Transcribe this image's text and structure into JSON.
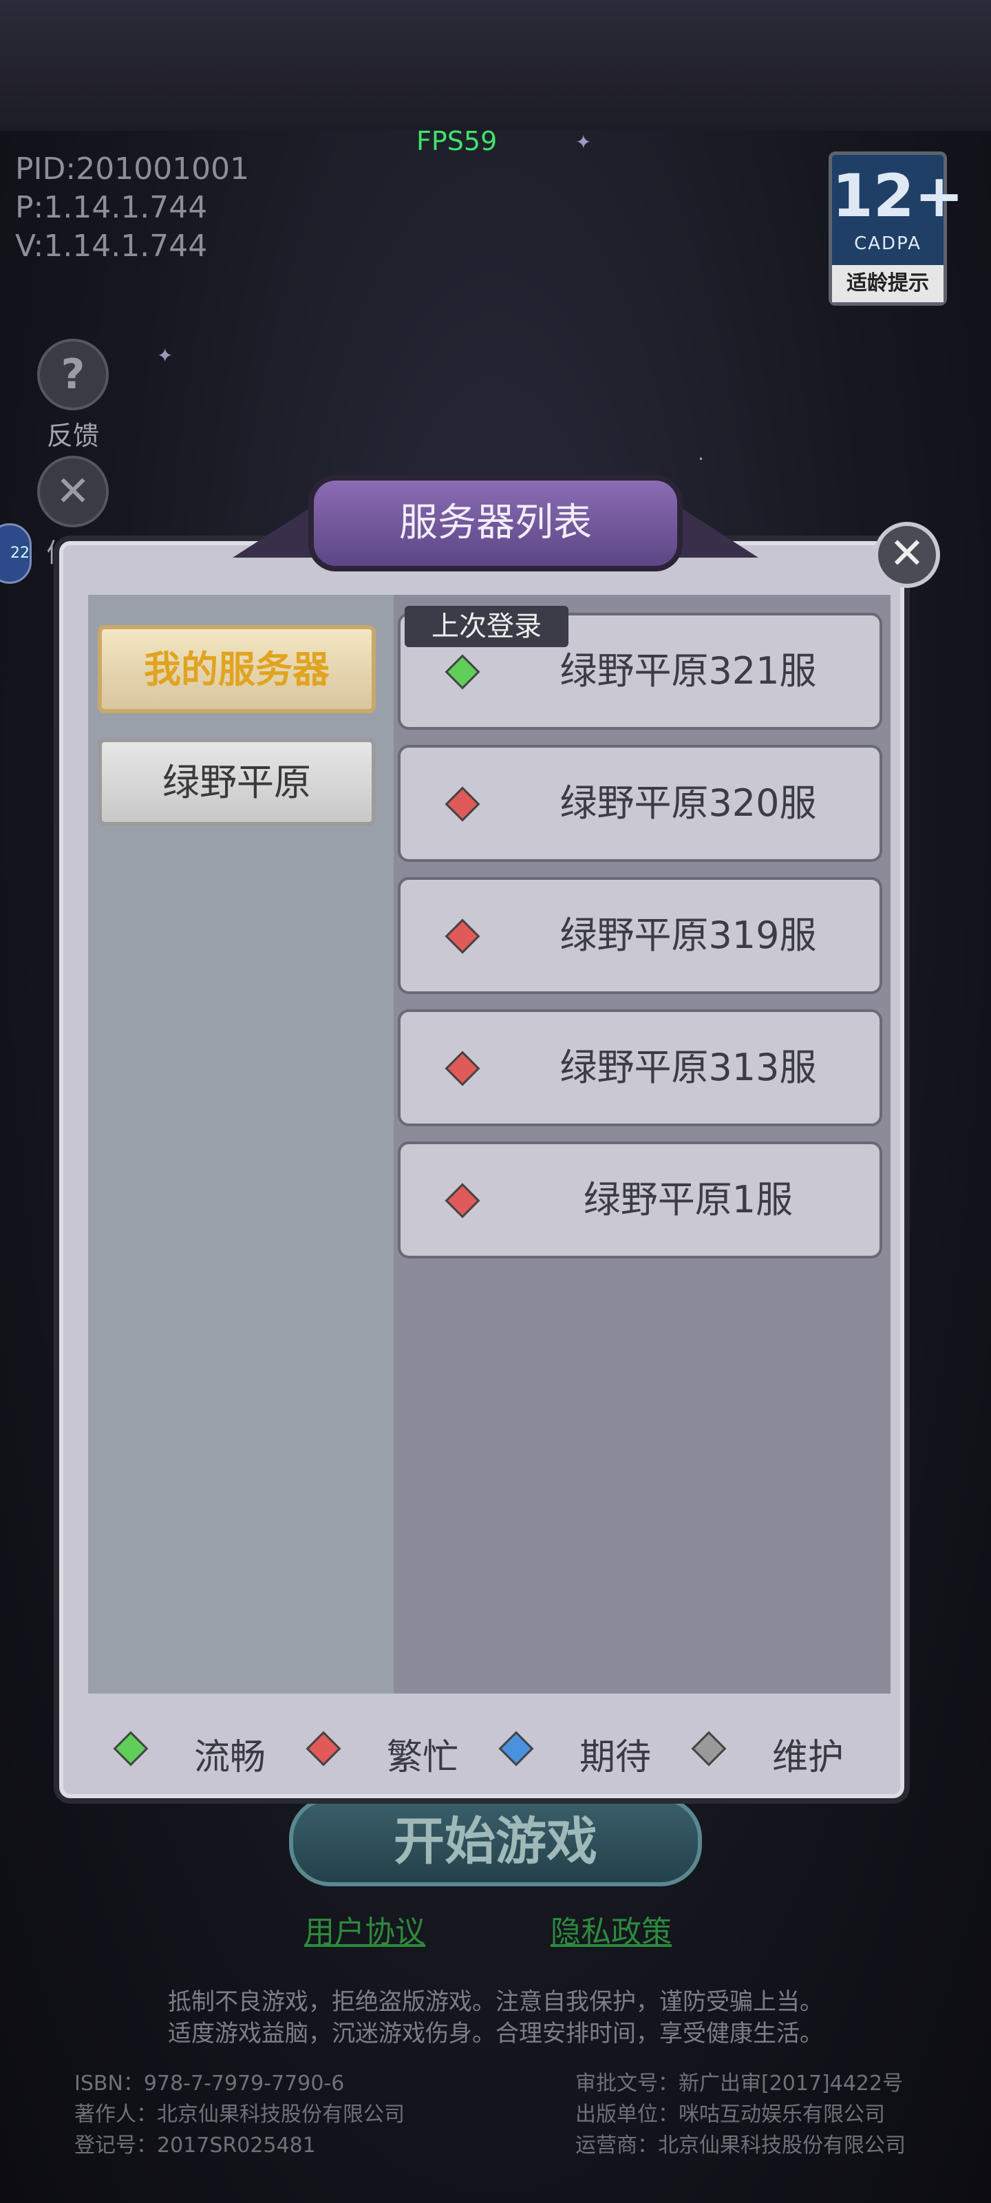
{
  "hud": {
    "fps": "FPS59",
    "pid": "PID:201001001",
    "p_version": "P:1.14.1.744",
    "v_version": "V:1.14.1.744"
  },
  "age_badge": {
    "rating": "12+",
    "org": "CADPA",
    "tip": "适龄提示"
  },
  "side_menu": [
    {
      "label": "反馈",
      "icon": "question-icon"
    },
    {
      "label": "修复",
      "icon": "wrench-icon"
    }
  ],
  "dialog": {
    "title": "服务器列表",
    "categories": [
      {
        "label": "我的服务器",
        "active": true
      },
      {
        "label": "绿野平原",
        "active": false
      }
    ],
    "last_login_tag": "上次登录",
    "servers": [
      {
        "name": "绿野平原321服",
        "status": "流畅",
        "color": "#5fcf5a"
      },
      {
        "name": "绿野平原320服",
        "status": "繁忙",
        "color": "#e05a5a"
      },
      {
        "name": "绿野平原319服",
        "status": "繁忙",
        "color": "#e05a5a"
      },
      {
        "name": "绿野平原313服",
        "status": "繁忙",
        "color": "#e05a5a"
      },
      {
        "name": "绿野平原1服",
        "status": "繁忙",
        "color": "#e05a5a"
      }
    ],
    "legend": [
      {
        "label": "流畅",
        "color": "#5fcf5a"
      },
      {
        "label": "繁忙",
        "color": "#e05a5a"
      },
      {
        "label": "期待",
        "color": "#4a92e0"
      },
      {
        "label": "维护",
        "color": "#9a9a9a"
      }
    ]
  },
  "start_button": "开始游戏",
  "links": {
    "user_agreement": "用户协议",
    "privacy_policy": "隐私政策"
  },
  "notice": {
    "line1": "抵制不良游戏，拒绝盗版游戏。注意自我保护，谨防受骗上当。",
    "line2": "适度游戏益脑，沉迷游戏伤身。合理安排时间，享受健康生活。"
  },
  "legal": {
    "isbn": "ISBN：978-7-7979-7790-6",
    "author": "著作人：北京仙果科技股份有限公司",
    "reg": "登记号：2017SR025481",
    "approval": "审批文号：新广出审[2017]4422号",
    "publisher": "出版单位：咪咕互动娱乐有限公司",
    "operator": "运营商：北京仙果科技股份有限公司"
  }
}
